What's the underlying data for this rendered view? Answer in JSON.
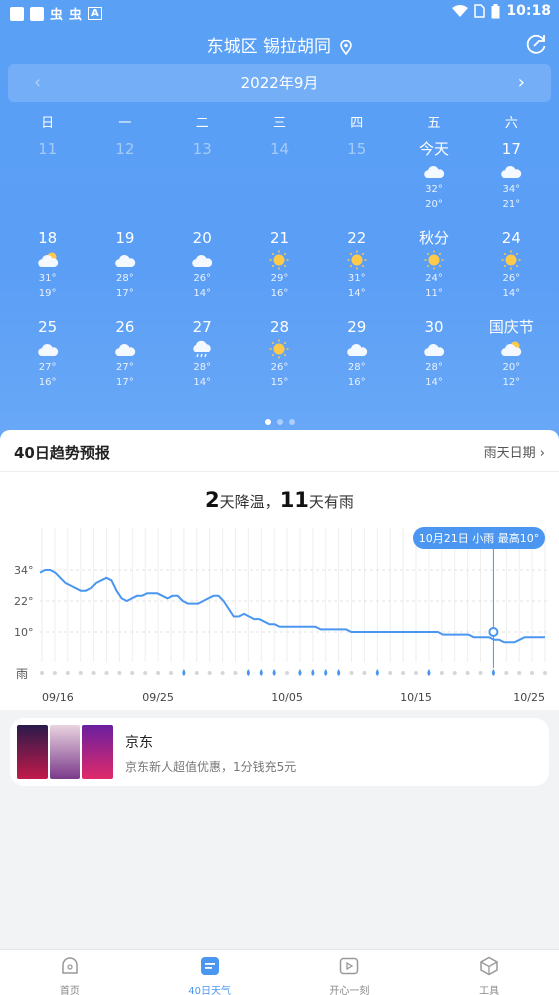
{
  "status": {
    "time": "10:18"
  },
  "location": {
    "name": "东城区 锡拉胡同"
  },
  "month": {
    "label": "2022年9月"
  },
  "weekdays": [
    "日",
    "一",
    "二",
    "三",
    "四",
    "五",
    "六"
  ],
  "weeks": [
    [
      {
        "d": "11",
        "past": true
      },
      {
        "d": "12",
        "past": true
      },
      {
        "d": "13",
        "past": true
      },
      {
        "d": "14",
        "past": true
      },
      {
        "d": "15",
        "past": true
      },
      {
        "d": "今天",
        "icon": "cloud",
        "hi": "32°",
        "lo": "20°"
      },
      {
        "d": "17",
        "icon": "cloud",
        "hi": "34°",
        "lo": "21°"
      }
    ],
    [
      {
        "d": "18",
        "icon": "partly",
        "hi": "31°",
        "lo": "19°"
      },
      {
        "d": "19",
        "icon": "cloud",
        "hi": "28°",
        "lo": "17°"
      },
      {
        "d": "20",
        "icon": "cloud",
        "hi": "26°",
        "lo": "14°"
      },
      {
        "d": "21",
        "icon": "sun",
        "hi": "29°",
        "lo": "16°"
      },
      {
        "d": "22",
        "icon": "sun",
        "hi": "31°",
        "lo": "14°"
      },
      {
        "d": "秋分",
        "icon": "sun",
        "hi": "24°",
        "lo": "11°"
      },
      {
        "d": "24",
        "icon": "sun",
        "hi": "26°",
        "lo": "14°"
      }
    ],
    [
      {
        "d": "25",
        "icon": "cloud",
        "hi": "27°",
        "lo": "16°"
      },
      {
        "d": "26",
        "icon": "cloud",
        "hi": "27°",
        "lo": "17°"
      },
      {
        "d": "27",
        "icon": "rain",
        "hi": "28°",
        "lo": "14°"
      },
      {
        "d": "28",
        "icon": "sun",
        "hi": "26°",
        "lo": "15°"
      },
      {
        "d": "29",
        "icon": "cloud",
        "hi": "28°",
        "lo": "16°"
      },
      {
        "d": "30",
        "icon": "cloud",
        "hi": "28°",
        "lo": "14°"
      },
      {
        "d": "国庆节",
        "icon": "partly",
        "hi": "20°",
        "lo": "12°"
      }
    ]
  ],
  "trend": {
    "title": "40日趋势预报",
    "link": "雨天日期",
    "cooling_days": "2",
    "cooling_text": "天降温，",
    "rain_days": "11",
    "rain_text": "天有雨",
    "tooltip": "10月21日 小雨 最高10°"
  },
  "chart_data": {
    "type": "line",
    "yticks": [
      "34°",
      "22°",
      "10°"
    ],
    "rain_label": "雨",
    "xticks": [
      "09/16",
      "09/25",
      "10/05",
      "10/15",
      "10/25"
    ],
    "temps": [
      33,
      34,
      34,
      33,
      31,
      29,
      28,
      27,
      26,
      26,
      27,
      29,
      30,
      31,
      30,
      26,
      23,
      22,
      23,
      24,
      24,
      25,
      25,
      25,
      24,
      23,
      24,
      24,
      22,
      21,
      21,
      21,
      22,
      23,
      24,
      24,
      22,
      19,
      16,
      16,
      17,
      16,
      15,
      15,
      14,
      13,
      13,
      12,
      12,
      12,
      12,
      12,
      12,
      12,
      12,
      11,
      11,
      11,
      11,
      11,
      11,
      10,
      10,
      10,
      10,
      10,
      10,
      10,
      10,
      10,
      10,
      10,
      10,
      10,
      10,
      10,
      10,
      10,
      10,
      9,
      9,
      9,
      9,
      9,
      9,
      8,
      8,
      8,
      8,
      7,
      7,
      6,
      6,
      6,
      7,
      8,
      8,
      8,
      8,
      8
    ],
    "rain_days": [
      11,
      16,
      17,
      18,
      20,
      21,
      22,
      23,
      26,
      30,
      35
    ],
    "day_count": 40,
    "selected_day": 35
  },
  "ad": {
    "title": "京东",
    "desc": "京东新人超值优惠，1分钱充5元"
  },
  "tabs": [
    {
      "label": "首页"
    },
    {
      "label": "40日天气"
    },
    {
      "label": "开心一刻"
    },
    {
      "label": "工具"
    }
  ]
}
